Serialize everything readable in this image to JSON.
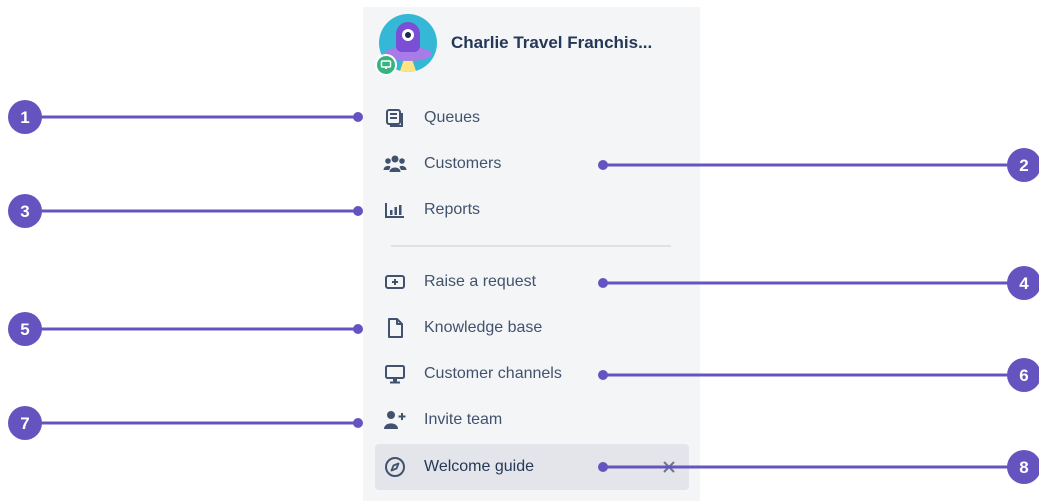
{
  "project": {
    "title": "Charlie Travel Franchis..."
  },
  "nav": {
    "queues": "Queues",
    "customers": "Customers",
    "reports": "Reports",
    "raise_request": "Raise a request",
    "knowledge_base": "Knowledge base",
    "customer_channels": "Customer channels",
    "invite_team": "Invite team",
    "welcome_guide": "Welcome guide"
  },
  "callouts": [
    "1",
    "2",
    "3",
    "4",
    "5",
    "6",
    "7",
    "8"
  ],
  "colors": {
    "accent": "#6554c0",
    "sidebar_bg": "#f4f5f7",
    "selected_bg": "#e3e5ea",
    "text": "#42526e",
    "badge_green": "#36b37e"
  },
  "icons": {
    "queues": "queues-icon",
    "customers": "customers-icon",
    "reports": "reports-icon",
    "raise_request": "raise-request-icon",
    "knowledge_base": "page-icon",
    "customer_channels": "monitor-icon",
    "invite_team": "person-add-icon",
    "welcome_guide": "compass-icon",
    "close": "close-icon"
  }
}
